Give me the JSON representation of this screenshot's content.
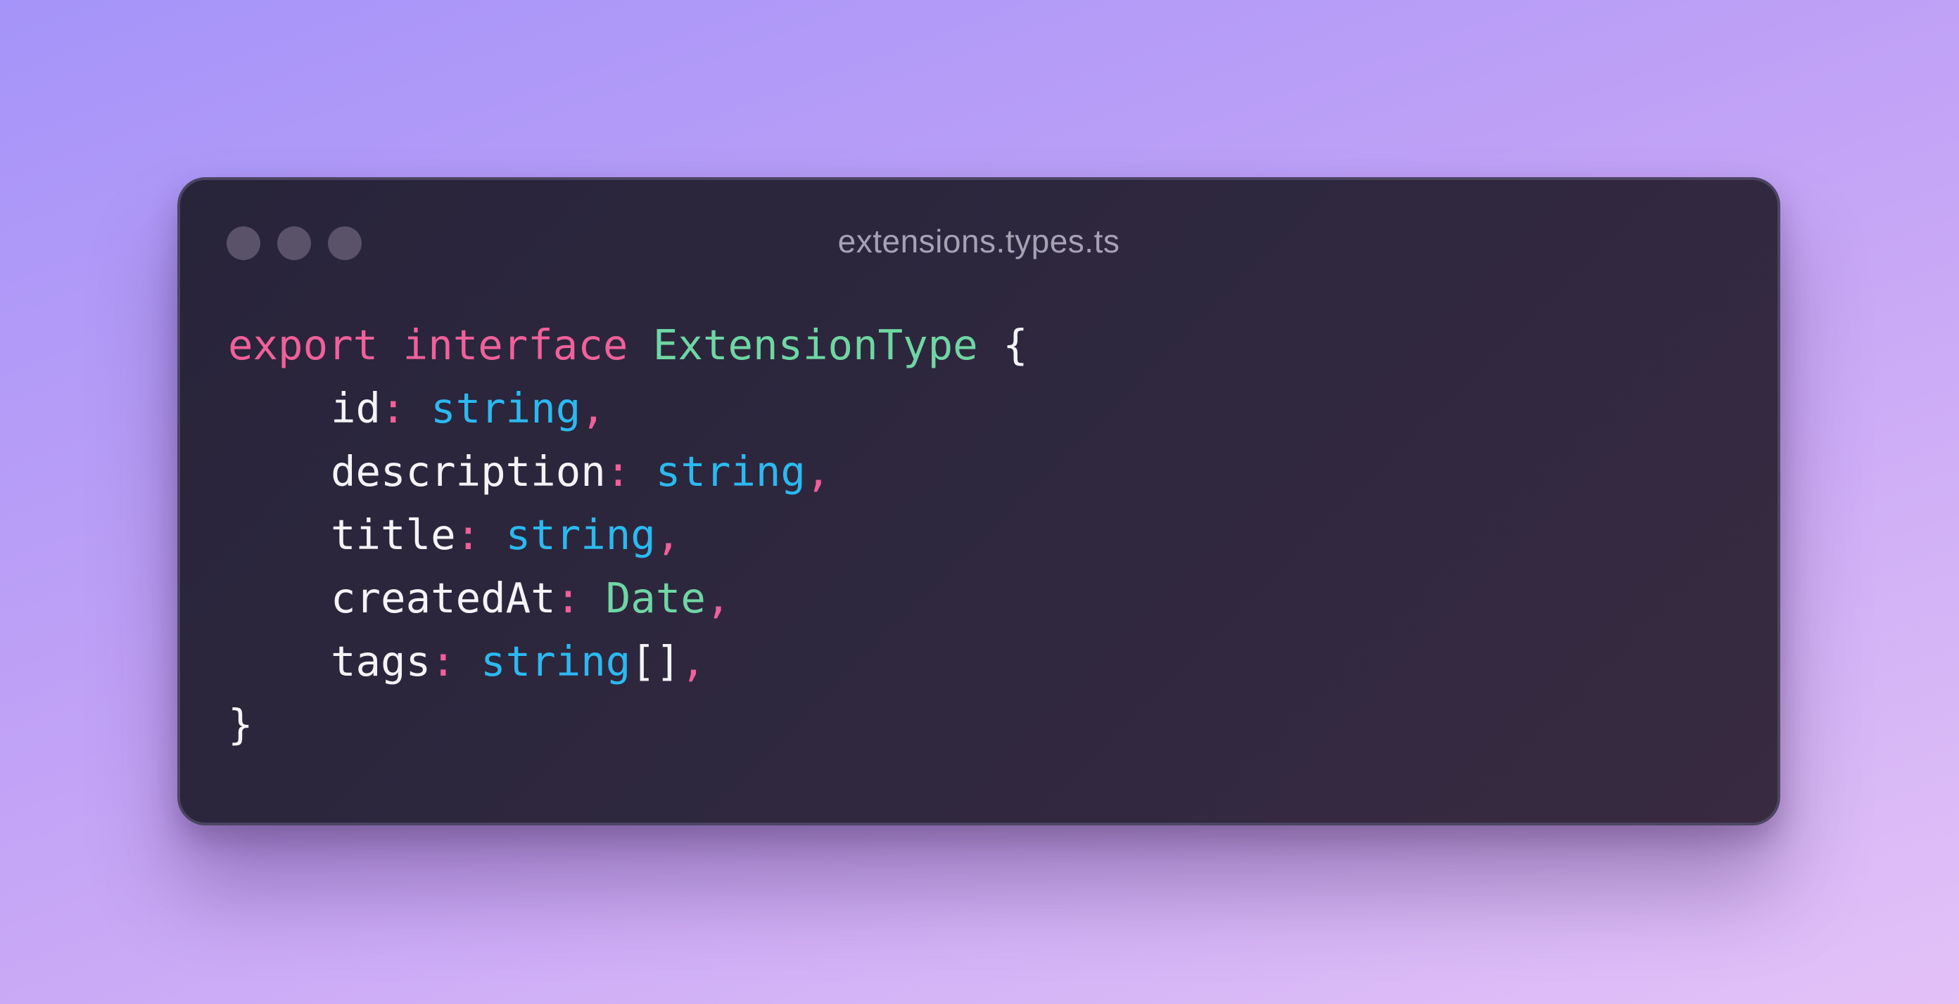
{
  "window": {
    "filename": "extensions.types.ts",
    "buttons": [
      "close",
      "minimize",
      "maximize"
    ]
  },
  "code": {
    "line1": {
      "kw_export": "export",
      "kw_interface": "interface",
      "name": "ExtensionType",
      "open_brace": "{"
    },
    "fields": [
      {
        "name": "id",
        "colon": ":",
        "type": "string",
        "suffix": "",
        "comma": ","
      },
      {
        "name": "description",
        "colon": ":",
        "type": "string",
        "suffix": "",
        "comma": ","
      },
      {
        "name": "title",
        "colon": ":",
        "type": "string",
        "suffix": "",
        "comma": ","
      },
      {
        "name": "createdAt",
        "colon": ":",
        "type": "Date",
        "suffix": "",
        "comma": ","
      },
      {
        "name": "tags",
        "colon": ":",
        "type": "string",
        "suffix": "[]",
        "comma": ","
      }
    ],
    "close_brace": "}"
  },
  "colors": {
    "keyword": "#f0609a",
    "interface_name": "#6fd6a3",
    "primitive_type": "#2bb9f0",
    "date_type": "#6fd6a3",
    "property": "#f4f4f7",
    "window_bg": "#2b2539",
    "background_gradient": [
      "#a594f9",
      "#e3c1f7"
    ]
  }
}
